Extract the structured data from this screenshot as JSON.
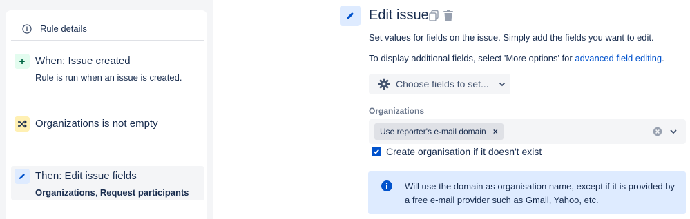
{
  "rule_panel": {
    "header_title": "Rule details",
    "components": [
      {
        "badge_icon": "plus-icon",
        "title": "When: Issue created",
        "subtitle": "Rule is run when an issue is created."
      },
      {
        "badge_icon": "shuffle-icon",
        "title": "Organizations is not empty"
      },
      {
        "badge_icon": "pencil-icon",
        "title": "Then: Edit issue fields",
        "fields": [
          "Organizations",
          "Request participants"
        ],
        "separator": ", "
      }
    ]
  },
  "edit_panel": {
    "title": "Edit issue",
    "description_line1": "Set values for fields on the issue. Simply add the fields you want to edit.",
    "description_line2_prefix": "To display additional fields, select 'More options' for ",
    "description_line2_link": "advanced field editing",
    "description_line2_suffix": ".",
    "choose_fields_label": "Choose fields to set...",
    "organizations_label": "Organizations",
    "organizations_tag": "Use reporter's e-mail domain",
    "tag_remove": "×",
    "checkbox_label": "Create organisation if it doesn't exist",
    "checkbox_checked": true,
    "info_message": "Will use the domain as organisation name, except if it is provided by a free e-mail provider such as Gmail, Yahoo, etc."
  },
  "colors": {
    "accent": "#0052cc",
    "info_bg": "#deebff",
    "trigger_bg": "#e3fcef",
    "condition_bg": "#fff0b3"
  }
}
